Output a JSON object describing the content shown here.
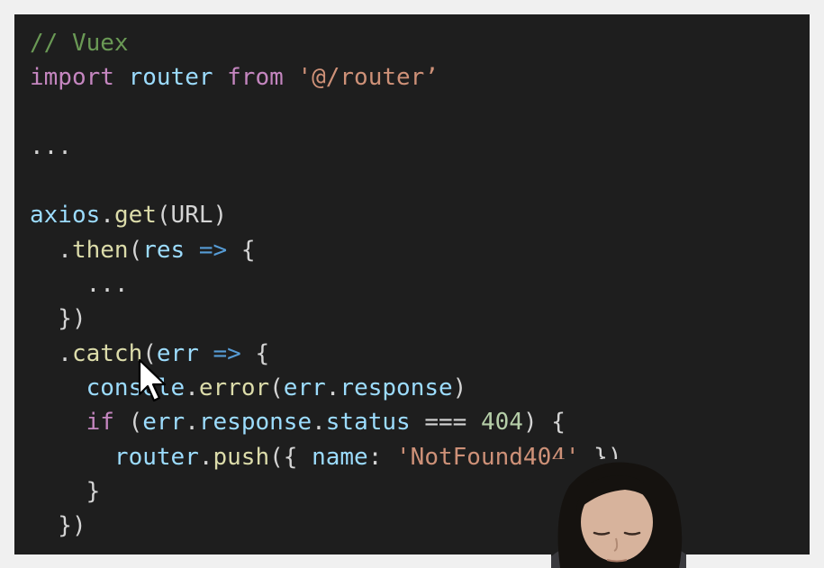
{
  "editor": {
    "lines": [
      [
        {
          "t": "// Vuex",
          "c": "comment"
        }
      ],
      [
        {
          "t": "import",
          "c": "keyword"
        },
        {
          "t": " ",
          "c": "plain"
        },
        {
          "t": "router",
          "c": "ident"
        },
        {
          "t": " ",
          "c": "plain"
        },
        {
          "t": "from",
          "c": "keyword"
        },
        {
          "t": " ",
          "c": "plain"
        },
        {
          "t": "'@/router’",
          "c": "string"
        }
      ],
      [],
      [
        {
          "t": "...",
          "c": "plain"
        }
      ],
      [],
      [
        {
          "t": "axios",
          "c": "ident"
        },
        {
          "t": ".",
          "c": "punct"
        },
        {
          "t": "get",
          "c": "func"
        },
        {
          "t": "(URL)",
          "c": "punct"
        }
      ],
      [
        {
          "t": "  .",
          "c": "punct"
        },
        {
          "t": "then",
          "c": "func"
        },
        {
          "t": "(",
          "c": "punct"
        },
        {
          "t": "res",
          "c": "ident"
        },
        {
          "t": " ",
          "c": "plain"
        },
        {
          "t": "=>",
          "c": "op"
        },
        {
          "t": " {",
          "c": "punct"
        }
      ],
      [
        {
          "t": "    ...",
          "c": "plain"
        }
      ],
      [
        {
          "t": "  })",
          "c": "punct"
        }
      ],
      [
        {
          "t": "  .",
          "c": "punct"
        },
        {
          "t": "catch",
          "c": "func"
        },
        {
          "t": "(",
          "c": "punct"
        },
        {
          "t": "err",
          "c": "ident"
        },
        {
          "t": " ",
          "c": "plain"
        },
        {
          "t": "=>",
          "c": "op"
        },
        {
          "t": " {",
          "c": "punct"
        }
      ],
      [
        {
          "t": "    ",
          "c": "plain"
        },
        {
          "t": "console",
          "c": "ident"
        },
        {
          "t": ".",
          "c": "punct"
        },
        {
          "t": "error",
          "c": "func"
        },
        {
          "t": "(",
          "c": "punct"
        },
        {
          "t": "err",
          "c": "ident"
        },
        {
          "t": ".",
          "c": "punct"
        },
        {
          "t": "response",
          "c": "ident"
        },
        {
          "t": ")",
          "c": "punct"
        }
      ],
      [
        {
          "t": "    ",
          "c": "plain"
        },
        {
          "t": "if",
          "c": "keyword"
        },
        {
          "t": " (",
          "c": "punct"
        },
        {
          "t": "err",
          "c": "ident"
        },
        {
          "t": ".",
          "c": "punct"
        },
        {
          "t": "response",
          "c": "ident"
        },
        {
          "t": ".",
          "c": "punct"
        },
        {
          "t": "status",
          "c": "ident"
        },
        {
          "t": " === ",
          "c": "punct"
        },
        {
          "t": "404",
          "c": "number"
        },
        {
          "t": ") {",
          "c": "punct"
        }
      ],
      [
        {
          "t": "      ",
          "c": "plain"
        },
        {
          "t": "router",
          "c": "ident"
        },
        {
          "t": ".",
          "c": "punct"
        },
        {
          "t": "push",
          "c": "func"
        },
        {
          "t": "({ ",
          "c": "punct"
        },
        {
          "t": "name",
          "c": "ident"
        },
        {
          "t": ": ",
          "c": "punct"
        },
        {
          "t": "'NotFound404'",
          "c": "string"
        },
        {
          "t": " })",
          "c": "punct"
        }
      ],
      [
        {
          "t": "    }",
          "c": "punct"
        }
      ],
      [
        {
          "t": "  })",
          "c": "punct"
        }
      ]
    ]
  },
  "colors": {
    "background": "#1e1e1e",
    "comment": "#6a9955",
    "keyword": "#c586c0",
    "identifier": "#9cdcfe",
    "function": "#dcdcaa",
    "string": "#ce9178",
    "number": "#b5cea8",
    "operator": "#569cd6",
    "text": "#d4d4d4"
  },
  "overlays": {
    "cursor": "arrow-pointer-icon",
    "webcam": "presenter-webcam"
  }
}
